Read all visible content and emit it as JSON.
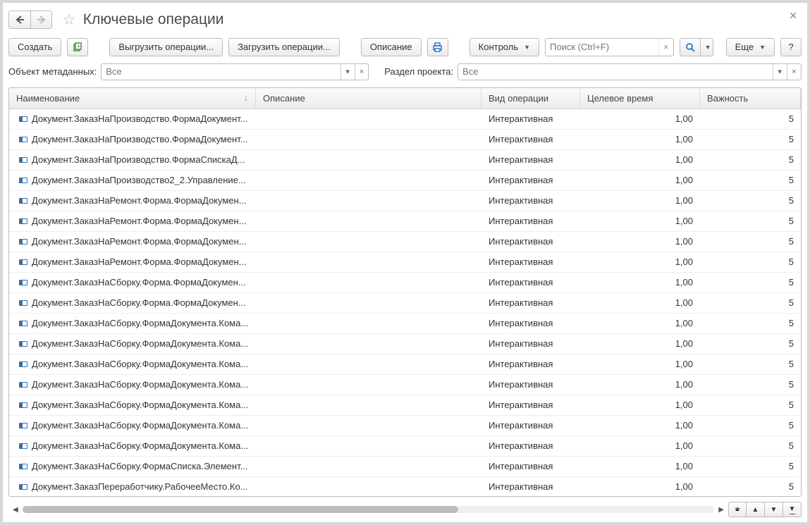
{
  "window": {
    "title": "Ключевые операции"
  },
  "toolbar": {
    "create": "Создать",
    "export": "Выгрузить операции...",
    "import": "Загрузить операции...",
    "description": "Описание",
    "control": "Контроль",
    "search_placeholder": "Поиск (Ctrl+F)",
    "more": "Еще",
    "help": "?"
  },
  "filters": {
    "metadata_label": "Объект метаданных:",
    "metadata_placeholder": "Все",
    "section_label": "Раздел проекта:",
    "section_placeholder": "Все"
  },
  "columns": {
    "name": "Наименование",
    "desc": "Описание",
    "type": "Вид операции",
    "time": "Целевое время",
    "imp": "Важность"
  },
  "rows": [
    {
      "name": "Документ.ЗаказНаПроизводство.ФормаДокумент...",
      "desc": "",
      "type": "Интерактивная",
      "time": "1,00",
      "imp": "5"
    },
    {
      "name": "Документ.ЗаказНаПроизводство.ФормаДокумент...",
      "desc": "",
      "type": "Интерактивная",
      "time": "1,00",
      "imp": "5"
    },
    {
      "name": "Документ.ЗаказНаПроизводство.ФормаСпискаД...",
      "desc": "",
      "type": "Интерактивная",
      "time": "1,00",
      "imp": "5"
    },
    {
      "name": "Документ.ЗаказНаПроизводство2_2.Управление...",
      "desc": "",
      "type": "Интерактивная",
      "time": "1,00",
      "imp": "5"
    },
    {
      "name": "Документ.ЗаказНаРемонт.Форма.ФормаДокумен...",
      "desc": "",
      "type": "Интерактивная",
      "time": "1,00",
      "imp": "5"
    },
    {
      "name": "Документ.ЗаказНаРемонт.Форма.ФормаДокумен...",
      "desc": "",
      "type": "Интерактивная",
      "time": "1,00",
      "imp": "5"
    },
    {
      "name": "Документ.ЗаказНаРемонт.Форма.ФормаДокумен...",
      "desc": "",
      "type": "Интерактивная",
      "time": "1,00",
      "imp": "5"
    },
    {
      "name": "Документ.ЗаказНаРемонт.Форма.ФормаДокумен...",
      "desc": "",
      "type": "Интерактивная",
      "time": "1,00",
      "imp": "5"
    },
    {
      "name": "Документ.ЗаказНаСборку.Форма.ФормаДокумен...",
      "desc": "",
      "type": "Интерактивная",
      "time": "1,00",
      "imp": "5"
    },
    {
      "name": "Документ.ЗаказНаСборку.Форма.ФормаДокумен...",
      "desc": "",
      "type": "Интерактивная",
      "time": "1,00",
      "imp": "5"
    },
    {
      "name": "Документ.ЗаказНаСборку.ФормаДокумента.Кома...",
      "desc": "",
      "type": "Интерактивная",
      "time": "1,00",
      "imp": "5"
    },
    {
      "name": "Документ.ЗаказНаСборку.ФормаДокумента.Кома...",
      "desc": "",
      "type": "Интерактивная",
      "time": "1,00",
      "imp": "5"
    },
    {
      "name": "Документ.ЗаказНаСборку.ФормаДокумента.Кома...",
      "desc": "",
      "type": "Интерактивная",
      "time": "1,00",
      "imp": "5"
    },
    {
      "name": "Документ.ЗаказНаСборку.ФормаДокумента.Кома...",
      "desc": "",
      "type": "Интерактивная",
      "time": "1,00",
      "imp": "5"
    },
    {
      "name": "Документ.ЗаказНаСборку.ФормаДокумента.Кома...",
      "desc": "",
      "type": "Интерактивная",
      "time": "1,00",
      "imp": "5"
    },
    {
      "name": "Документ.ЗаказНаСборку.ФормаДокумента.Кома...",
      "desc": "",
      "type": "Интерактивная",
      "time": "1,00",
      "imp": "5"
    },
    {
      "name": "Документ.ЗаказНаСборку.ФормаДокумента.Кома...",
      "desc": "",
      "type": "Интерактивная",
      "time": "1,00",
      "imp": "5"
    },
    {
      "name": "Документ.ЗаказНаСборку.ФормаСписка.Элемент...",
      "desc": "",
      "type": "Интерактивная",
      "time": "1,00",
      "imp": "5"
    },
    {
      "name": "Документ.ЗаказПереработчику.РабочееМесто.Ко...",
      "desc": "",
      "type": "Интерактивная",
      "time": "1,00",
      "imp": "5"
    }
  ]
}
